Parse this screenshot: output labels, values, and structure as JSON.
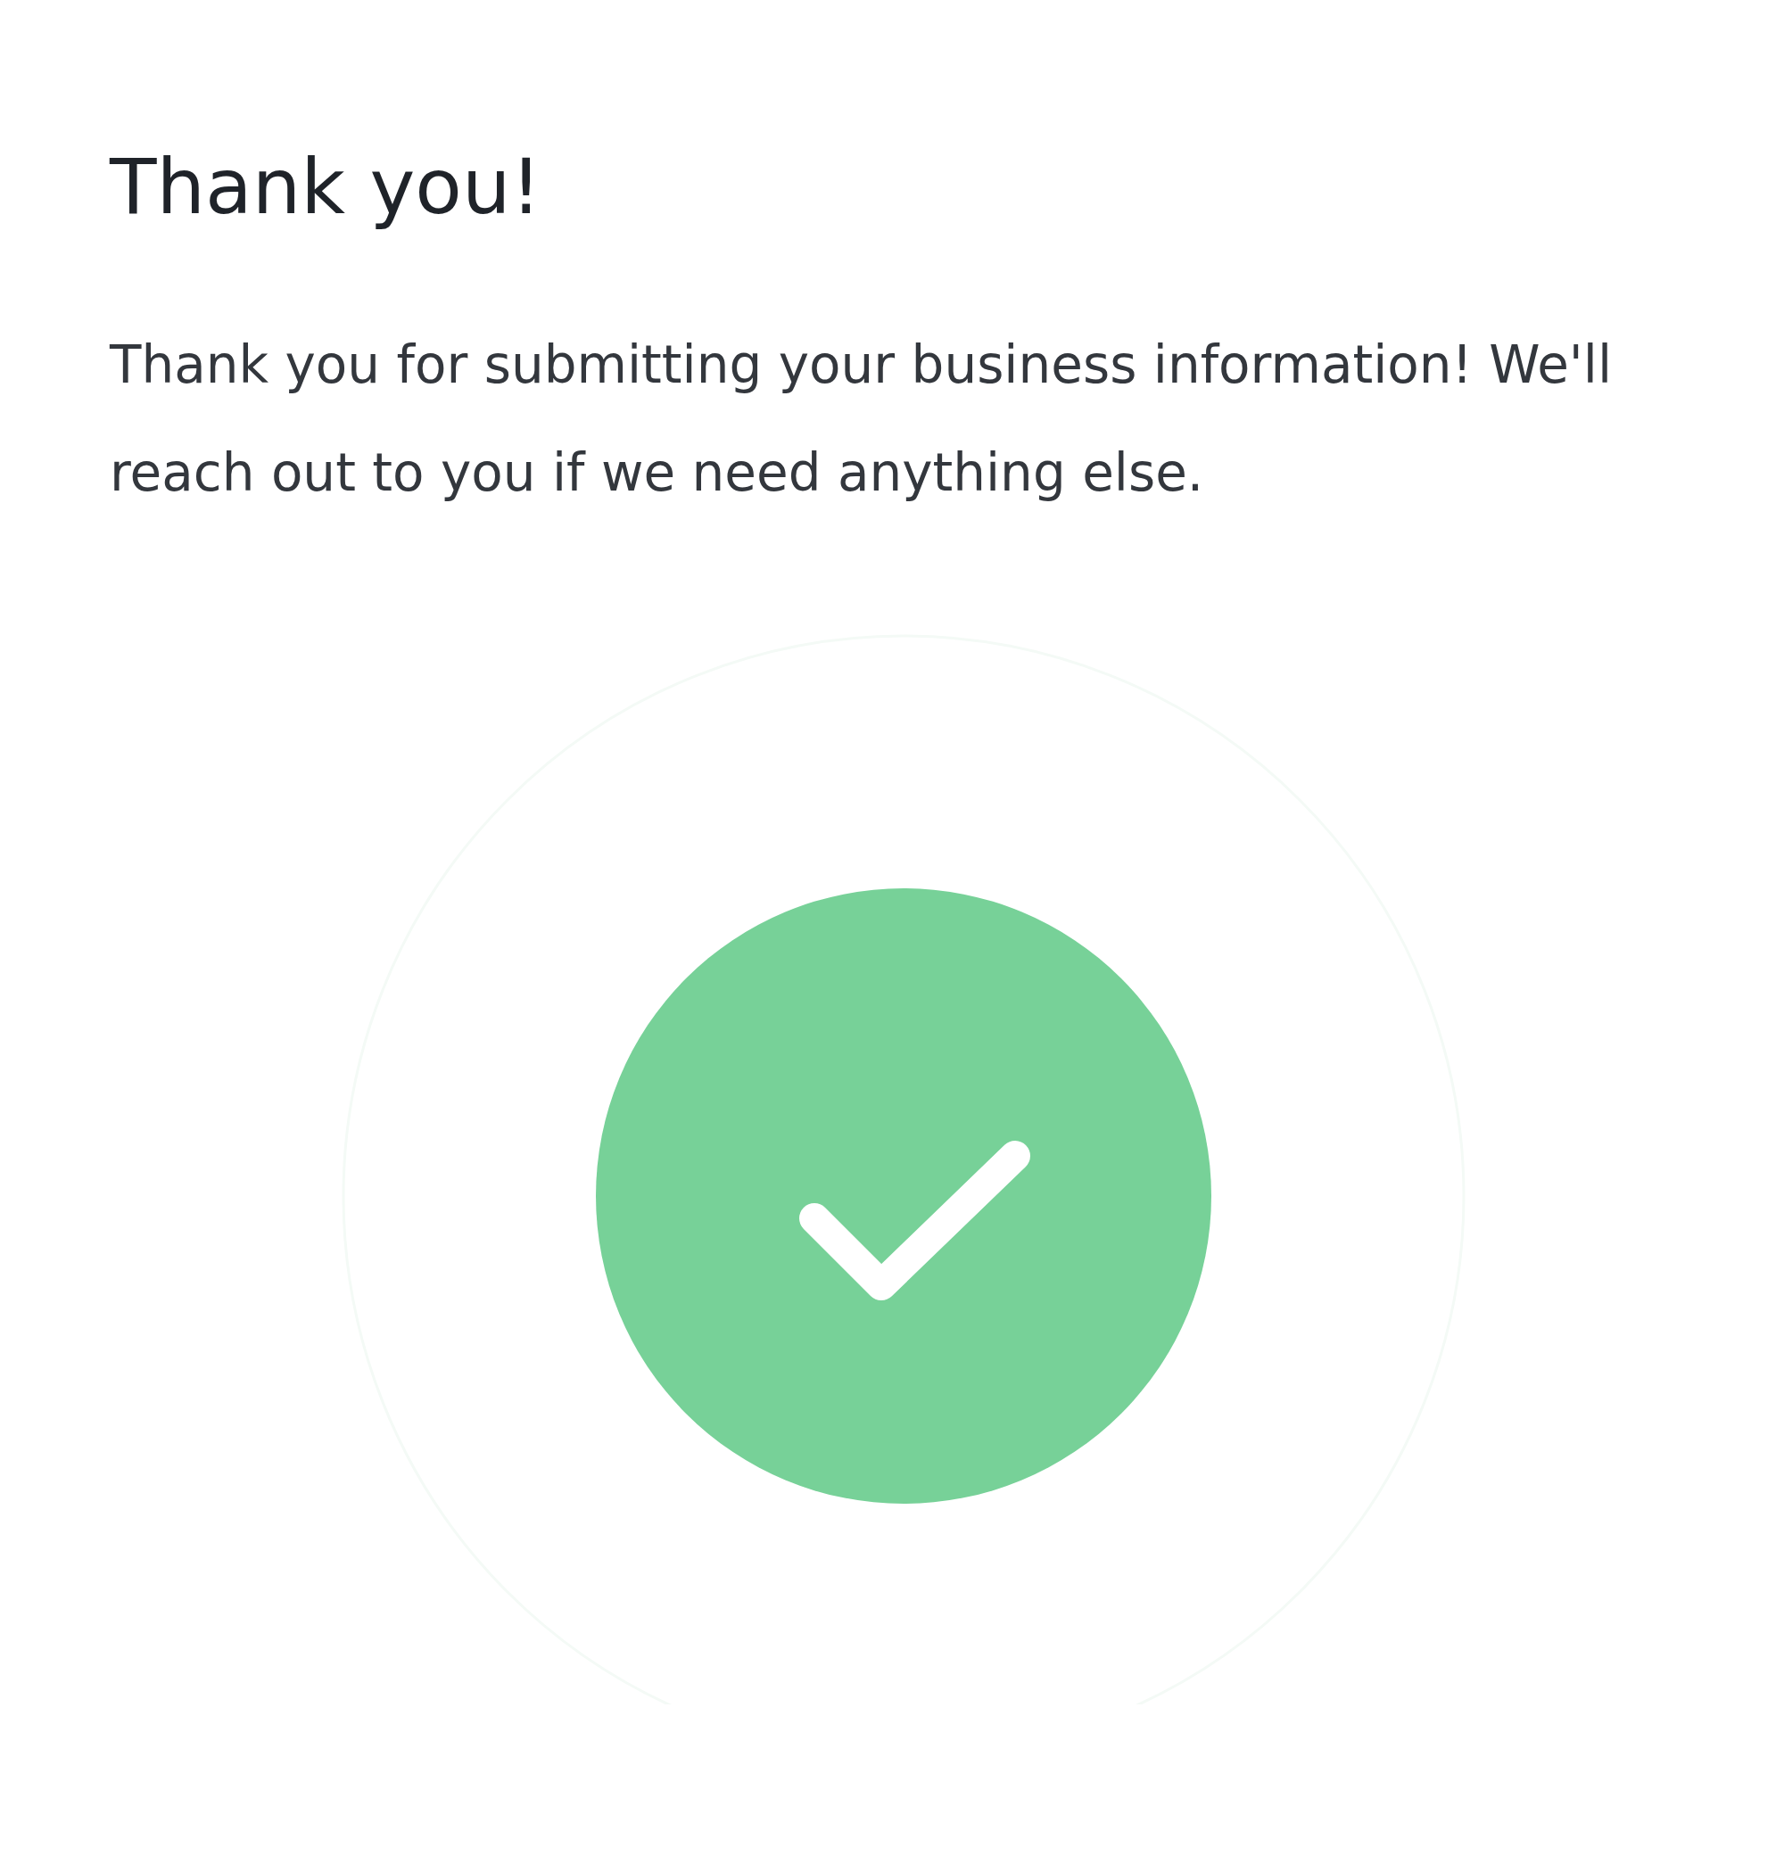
{
  "title": "Thank you!",
  "message": "Thank you for submitting your business information! We'll reach out to you if we need anything else."
}
